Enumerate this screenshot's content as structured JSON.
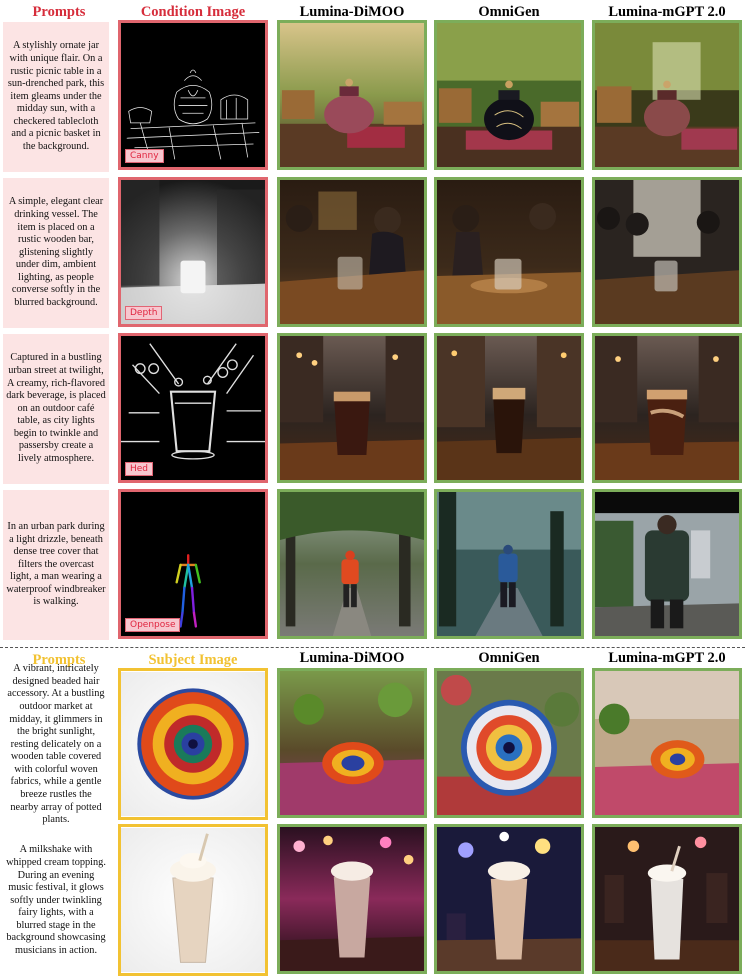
{
  "colors": {
    "condition_header": "#d62d3b",
    "subject_header": "#f2c232",
    "condition_border": "#e0666e",
    "generated_border": "#7cad5a",
    "subject_border": "#f2c232",
    "prompt_bg": "#fce4e4"
  },
  "section1": {
    "headers": {
      "prompts": "Prompts",
      "condition": "Condition Image",
      "m1": "Lumina-DiMOO",
      "m2": "OmniGen",
      "m3": "Lumina-mGPT 2.0"
    },
    "rows": [
      {
        "prompt": "A stylishly ornate jar with unique flair. On a rustic picnic table in a sun-drenched park, this item gleams under the midday sun, with a checkered tablecloth and a picnic basket in the background.",
        "condition_label": "Canny"
      },
      {
        "prompt": "A simple, elegant clear drinking vessel. The item is placed on a rustic wooden bar, glistening slightly under dim, ambient lighting, as people converse softly in the blurred background.",
        "condition_label": "Depth"
      },
      {
        "prompt": "Captured in a bustling urban street at twilight, A creamy, rich-flavored dark beverage, is placed on an outdoor café table, as city lights begin to twinkle and passersby create a lively atmosphere.",
        "condition_label": "Hed"
      },
      {
        "prompt": "In an urban park during a light drizzle, beneath dense tree cover that filters the overcast light,  a man wearing a waterproof windbreaker is walking.",
        "condition_label": "Openpose"
      }
    ]
  },
  "section2": {
    "headers": {
      "prompts": "Prompts",
      "subject": "Subject Image",
      "m1": "Lumina-DiMOO",
      "m2": "OmniGen",
      "m3": "Lumina-mGPT 2.0"
    },
    "rows": [
      {
        "prompt": "A vibrant, intricately designed beaded hair accessory. At a bustling outdoor market at midday, it glimmers in the bright sunlight, resting delicately on a wooden table covered with colorful woven fabrics, while a gentle breeze rustles the nearby array of potted plants."
      },
      {
        "prompt": "A milkshake with whipped cream topping. During an evening music festival, it glows softly under twinkling fairy lights, with a blurred stage in the background showcasing musicians in action."
      }
    ]
  }
}
